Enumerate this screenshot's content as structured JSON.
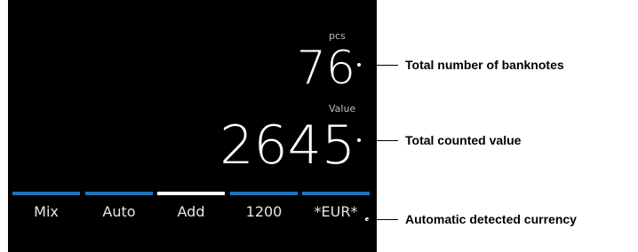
{
  "display": {
    "pcs_label": "pcs",
    "count": "76",
    "value_label": "Value",
    "total_value": "2645"
  },
  "tabs": [
    {
      "label": "Mix",
      "bar_color": "#1e73be",
      "active": false
    },
    {
      "label": "Auto",
      "bar_color": "#1e73be",
      "active": false
    },
    {
      "label": "Add",
      "bar_color": "#ffffff",
      "active": true
    },
    {
      "label": "1200",
      "bar_color": "#1e73be",
      "active": false
    },
    {
      "label": "*EUR*",
      "bar_color": "#1e73be",
      "active": false
    }
  ],
  "callouts": {
    "count": "Total number of banknotes",
    "value": "Total counted value",
    "currency": "Automatic detected currency"
  },
  "colors": {
    "screen_background": "#000000",
    "accent_blue": "#1e73be",
    "active_white": "#ffffff"
  }
}
